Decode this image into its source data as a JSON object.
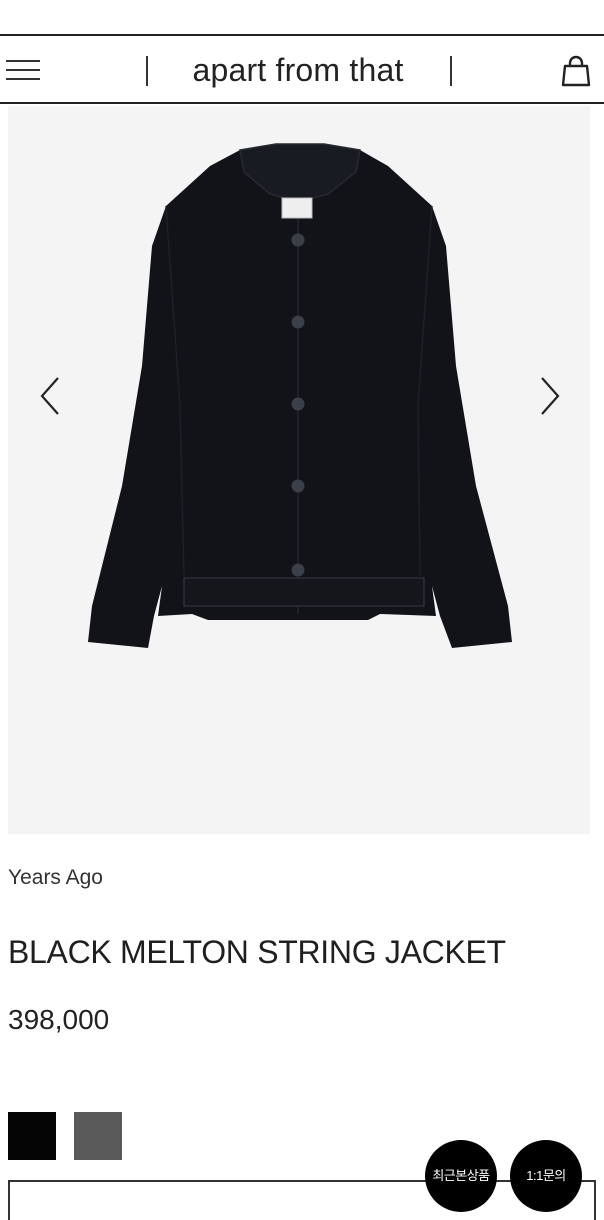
{
  "header": {
    "brand": "apart from that",
    "menu_icon": "hamburger-menu-icon",
    "cart_icon": "shopping-bag-icon"
  },
  "gallery": {
    "prev_icon": "chevron-left-icon",
    "next_icon": "chevron-right-icon"
  },
  "product": {
    "brand_name": "Years Ago",
    "title": "BLACK MELTON STRING JACKET",
    "price": "398,000",
    "swatches": [
      {
        "color": "#050505"
      },
      {
        "color": "#5a5a5a"
      }
    ]
  },
  "floating": {
    "recent_label": "최근본상품",
    "inquiry_label": "1:1문의"
  },
  "colors": {
    "background": "#ffffff",
    "gallery_bg": "#f4f4f4",
    "jacket": "#111318",
    "floating_bg": "#000000"
  }
}
